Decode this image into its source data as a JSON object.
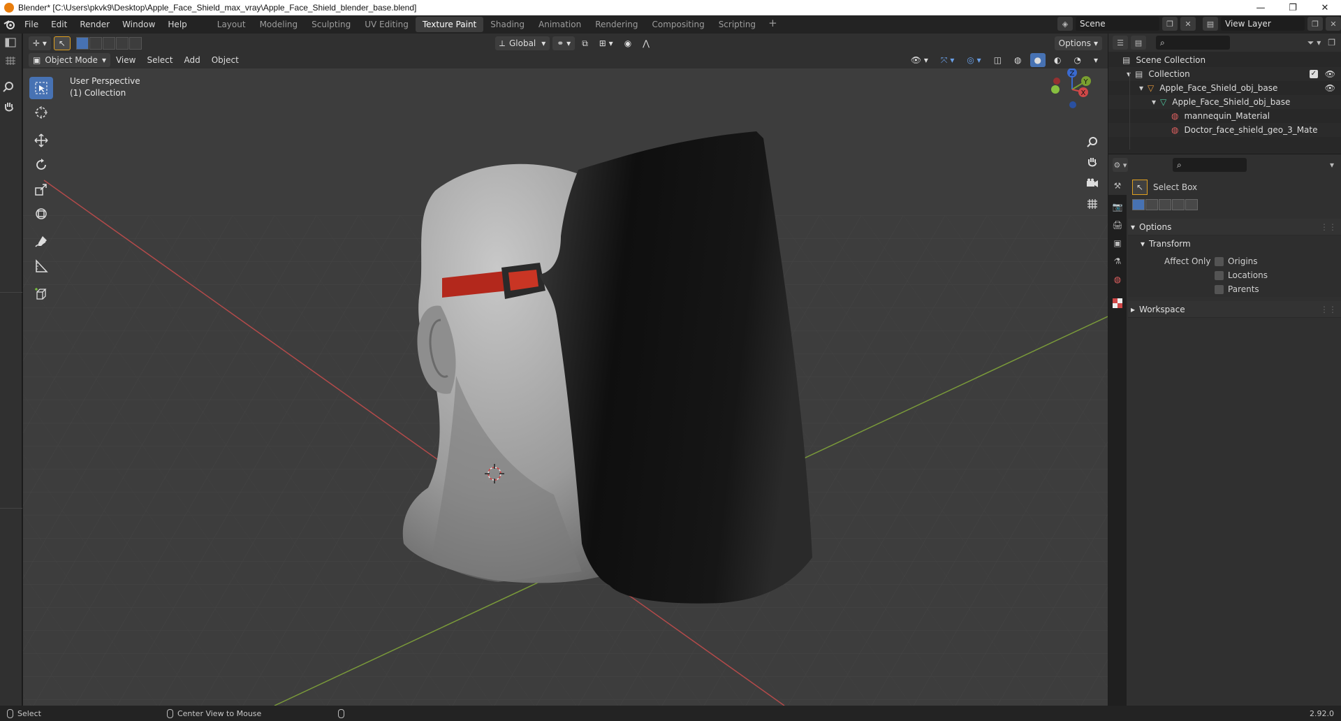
{
  "window": {
    "title": "Blender* [C:\\Users\\pkvk9\\Desktop\\Apple_Face_Shield_max_vray\\Apple_Face_Shield_blender_base.blend]",
    "buttons": [
      "—",
      "❐",
      "✕"
    ]
  },
  "menu": {
    "items": [
      "File",
      "Edit",
      "Render",
      "Window",
      "Help"
    ]
  },
  "workspaces": {
    "tabs": [
      "Layout",
      "Modeling",
      "Sculpting",
      "UV Editing",
      "Texture Paint",
      "Shading",
      "Animation",
      "Rendering",
      "Compositing",
      "Scripting"
    ],
    "active": "Texture Paint",
    "add": "+"
  },
  "scene": {
    "name": "Scene",
    "view_layer": "View Layer"
  },
  "viewport_header": {
    "transform_orientation": "Global",
    "options_label": "Options",
    "mode": "Object Mode",
    "menus": [
      "View",
      "Select",
      "Add",
      "Object"
    ]
  },
  "viewport": {
    "perspective": "User Perspective",
    "collection": "(1) Collection",
    "gizmo_axes": {
      "x": "X",
      "y": "Y",
      "z": "Z"
    },
    "colors": {
      "background": "#3d3d3d",
      "x_axis": "#b34a4a",
      "y_axis": "#7a9a3a",
      "shield": "#1a1a1a",
      "strap": "#b3281c",
      "head": "#a8a8a8"
    }
  },
  "toolbar": {
    "tools": [
      "select-box-icon",
      "cursor-icon",
      "move-icon",
      "rotate-icon",
      "scale-icon",
      "transform-icon",
      "annotate-icon",
      "measure-icon",
      "add-cube-icon"
    ]
  },
  "outliner": {
    "root": "Scene Collection",
    "rows": [
      {
        "label": "Collection"
      },
      {
        "label": "Apple_Face_Shield_obj_base"
      },
      {
        "label": "Apple_Face_Shield_obj_base"
      },
      {
        "label": "mannequin_Material"
      },
      {
        "label": "Doctor_face_shield_geo_3_Mate"
      }
    ]
  },
  "properties": {
    "tool_name": "Select Box",
    "options_label": "Options",
    "transform_label": "Transform",
    "affect_only_label": "Affect Only",
    "affect_only": [
      {
        "label": "Origins",
        "checked": false
      },
      {
        "label": "Locations",
        "checked": false
      },
      {
        "label": "Parents",
        "checked": false
      }
    ],
    "workspace_label": "Workspace"
  },
  "statusbar": {
    "select": "Select",
    "center_view": "Center View to Mouse",
    "version": "2.92.0"
  }
}
